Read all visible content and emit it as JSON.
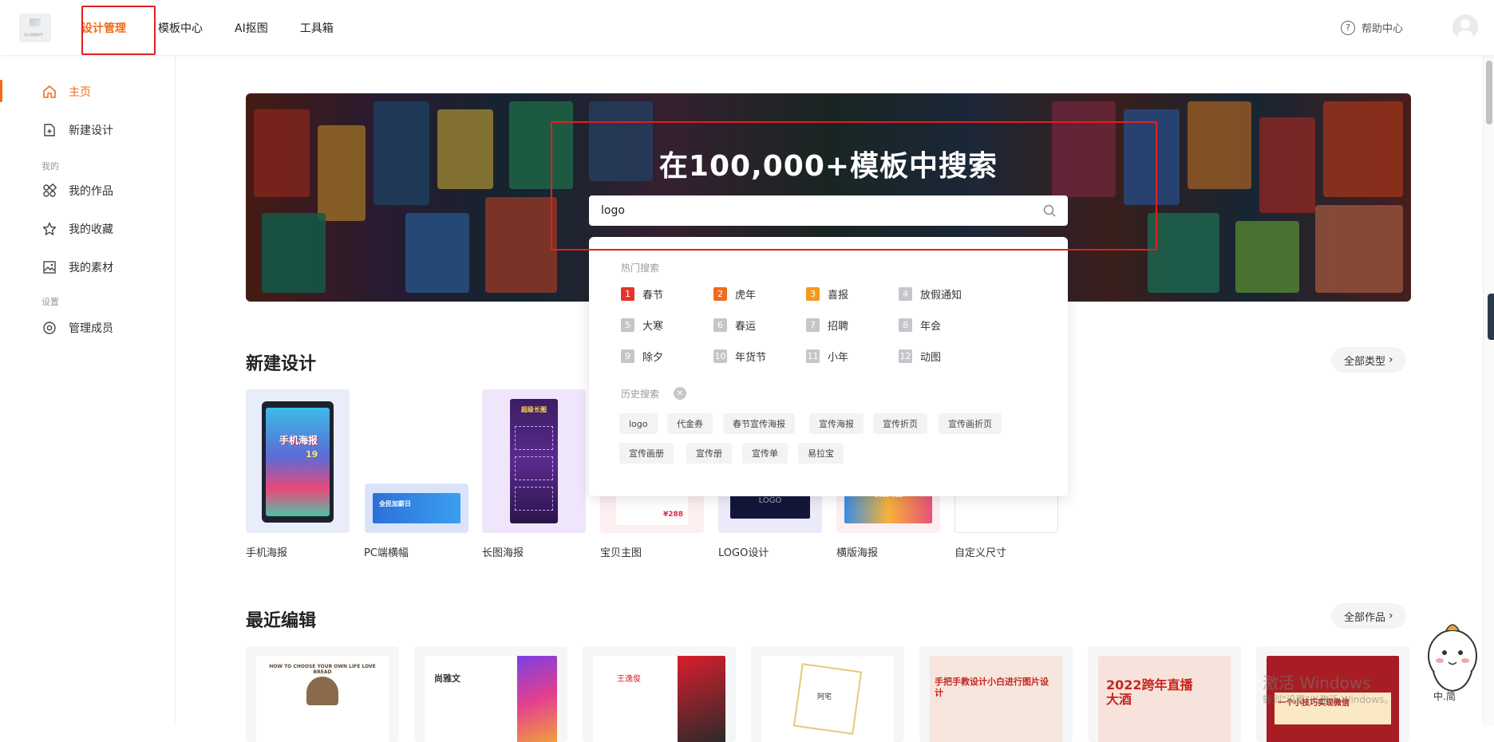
{
  "topbar": {
    "logo_text": "设计管理助手",
    "nav": [
      {
        "label": "设计管理"
      },
      {
        "label": "模板中心"
      },
      {
        "label": "AI抠图"
      },
      {
        "label": "工具箱"
      }
    ],
    "help_label": "帮助中心"
  },
  "sidebar": {
    "home": "主页",
    "new_design": "新建设计",
    "section_mine": "我的",
    "my_works": "我的作品",
    "my_favorites": "我的收藏",
    "my_materials": "我的素材",
    "section_settings": "设置",
    "manage_members": "管理成员"
  },
  "banner": {
    "title": "在100,000+模板中搜索",
    "search_value": "logo"
  },
  "dropdown": {
    "hot_label": "热门搜索",
    "hot": [
      {
        "rank": "1",
        "label": "春节",
        "color": "#e5332a"
      },
      {
        "rank": "2",
        "label": "虎年",
        "color": "#f06a1a"
      },
      {
        "rank": "3",
        "label": "喜报",
        "color": "#f29a1b"
      },
      {
        "rank": "4",
        "label": "放假通知",
        "color": "#c4c6ca"
      },
      {
        "rank": "5",
        "label": "大寒",
        "color": "#c4c6ca"
      },
      {
        "rank": "6",
        "label": "春运",
        "color": "#c4c6ca"
      },
      {
        "rank": "7",
        "label": "招聘",
        "color": "#c4c6ca"
      },
      {
        "rank": "8",
        "label": "年会",
        "color": "#c4c6ca"
      },
      {
        "rank": "9",
        "label": "除夕",
        "color": "#c4c6ca"
      },
      {
        "rank": "10",
        "label": "年货节",
        "color": "#c4c6ca"
      },
      {
        "rank": "11",
        "label": "小年",
        "color": "#c4c6ca"
      },
      {
        "rank": "12",
        "label": "动图",
        "color": "#c4c6ca"
      }
    ],
    "history_label": "历史搜索",
    "history": [
      "logo",
      "代金券",
      "春节宣传海报",
      "宣传海报",
      "宣传折页",
      "宣传画折页",
      "宣传画册",
      "宣传册",
      "宣传单",
      "易拉宝"
    ]
  },
  "new_design": {
    "title": "新建设计",
    "all_types": "全部类型",
    "cards": [
      {
        "label": "手机海报"
      },
      {
        "label": "PC端横幅"
      },
      {
        "label": "长图海报"
      },
      {
        "label": "宝贝主图"
      },
      {
        "label": "LOGO设计"
      },
      {
        "label": "横版海报"
      },
      {
        "label": "自定义尺寸"
      }
    ],
    "card_texts": {
      "mobile_poster": "手机海报",
      "mobile_sub": "19",
      "long_poster": "超级长图",
      "pc_banner": "全民加薪日",
      "logo": "LOGO",
      "horizontal": "横版海报",
      "price": "¥288"
    }
  },
  "recent": {
    "title": "最近编辑",
    "all_works": "全部作品",
    "thumb_texts": [
      "HOW TO CHOOSE YOUR OWN LIFE LOVE BREAD",
      "尚雅文",
      "王逸俊",
      "阿宅",
      "手把手教设计小白进行图片设计",
      "2022跨年直播大酒",
      "一个小技巧实现微信"
    ]
  },
  "watermark": {
    "line1": "激活 Windows",
    "line2": "转到\"设置\"以激活 Windows。"
  },
  "mascot_text": "中.简"
}
